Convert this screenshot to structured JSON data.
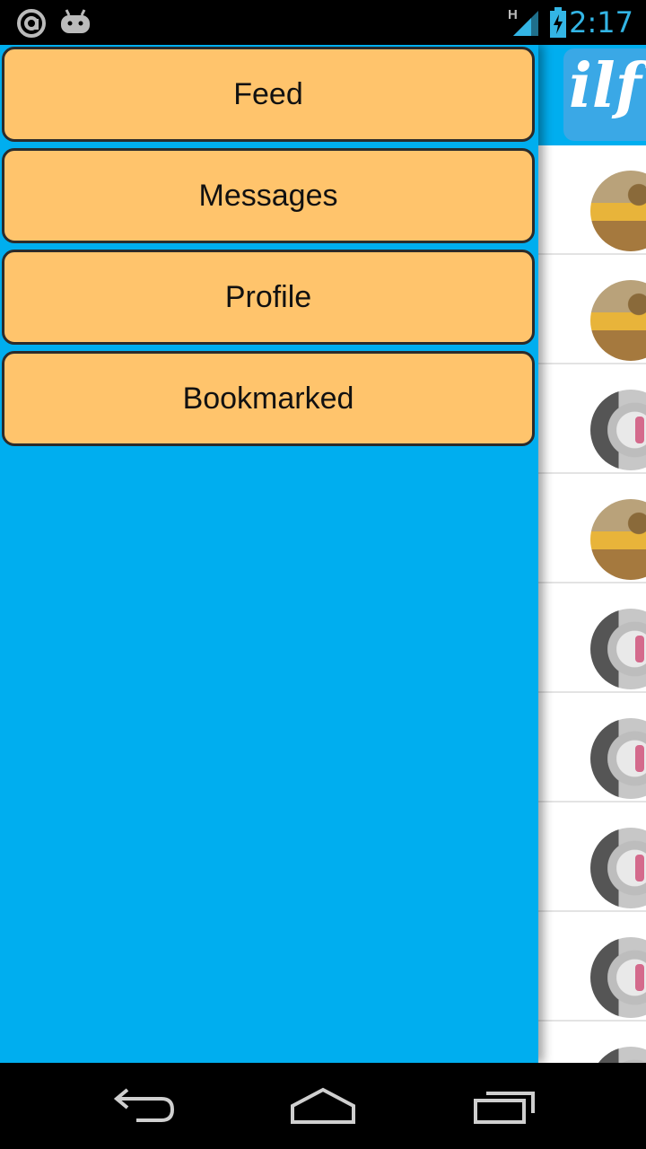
{
  "status_bar": {
    "time": "2:17",
    "network_label": "H",
    "icons": [
      "app-notification-icon",
      "android-debug-icon",
      "signal-icon",
      "battery-charging-icon"
    ]
  },
  "drawer": {
    "items": [
      {
        "label": "Feed"
      },
      {
        "label": "Messages"
      },
      {
        "label": "Profile"
      },
      {
        "label": "Bookmarked"
      }
    ]
  },
  "background_app": {
    "logo_text": "ilf",
    "rows": [
      "desk",
      "desk",
      "hamster",
      "desk",
      "hamster",
      "hamster",
      "hamster",
      "hamster",
      "hamster"
    ]
  },
  "nav_bar": {
    "icons": [
      "back-icon",
      "home-icon",
      "recent-apps-icon"
    ]
  },
  "colors": {
    "drawer_bg": "#00aeef",
    "button_bg": "#ffc46c",
    "button_border": "#2b2b2b",
    "status_accent": "#33b5e5"
  }
}
